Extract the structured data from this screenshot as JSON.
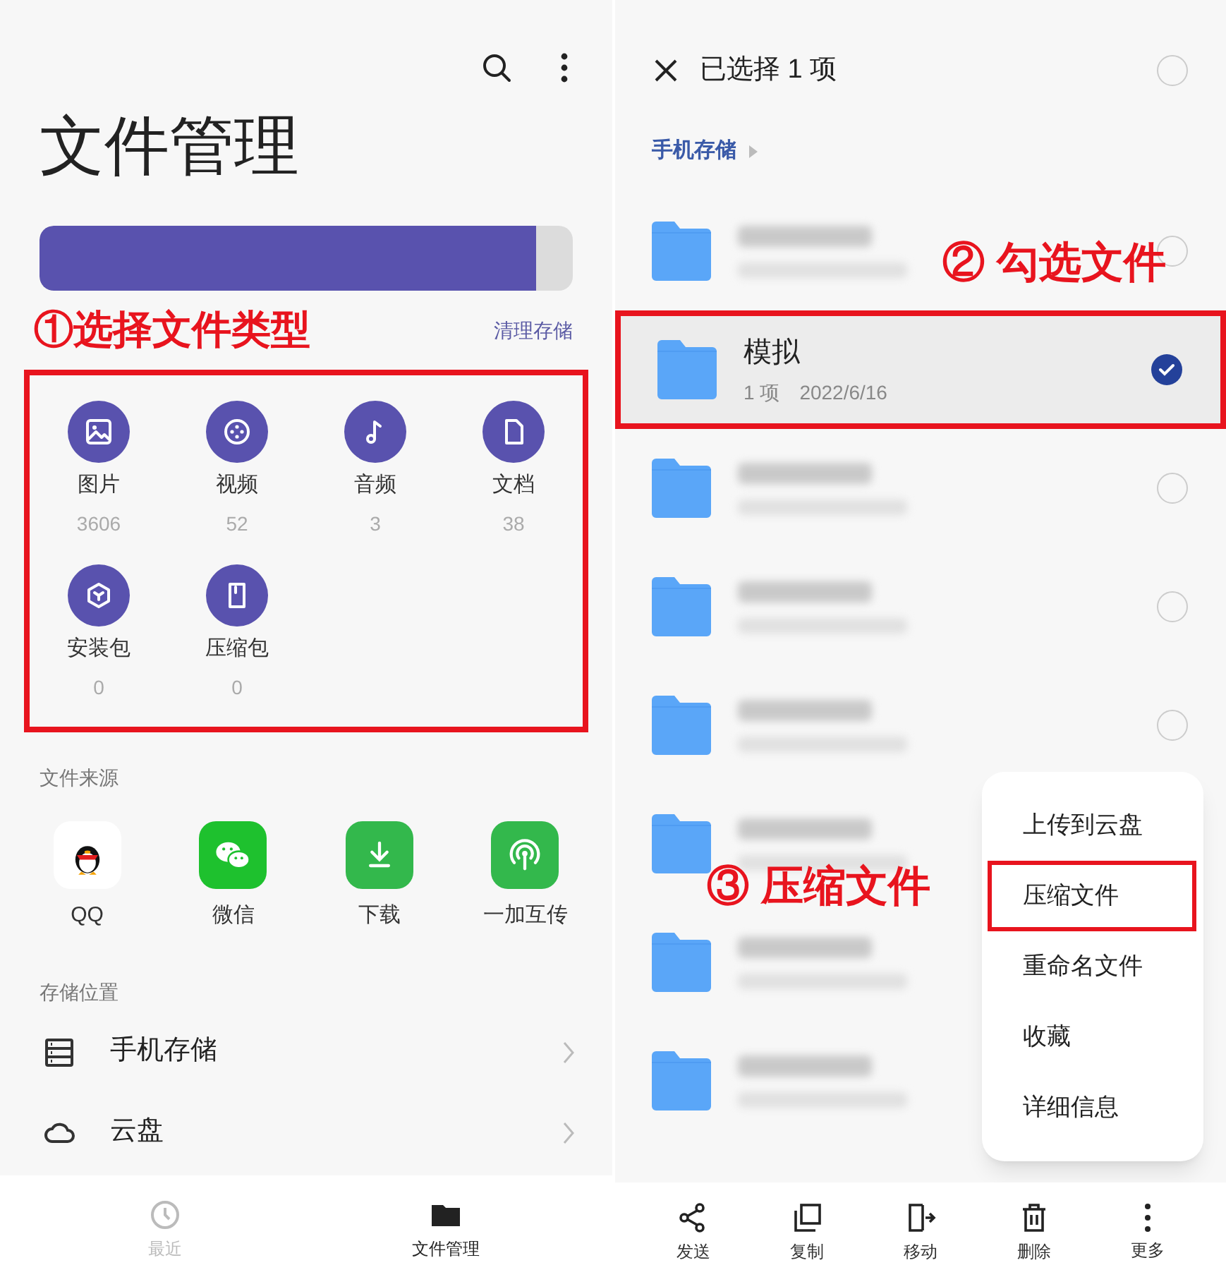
{
  "left": {
    "title": "文件管理",
    "storage": {
      "level": 0.93
    },
    "annotation": "①选择文件类型",
    "clean_link": "清理存储",
    "categories": [
      {
        "label": "图片",
        "count": "3606",
        "kind": "image"
      },
      {
        "label": "视频",
        "count": "52",
        "kind": "video"
      },
      {
        "label": "音频",
        "count": "3",
        "kind": "audio"
      },
      {
        "label": "文档",
        "count": "38",
        "kind": "doc"
      },
      {
        "label": "安装包",
        "count": "0",
        "kind": "package"
      },
      {
        "label": "压缩包",
        "count": "0",
        "kind": "archive"
      }
    ],
    "sources_heading": "文件来源",
    "sources": [
      {
        "label": "QQ",
        "kind": "qq"
      },
      {
        "label": "微信",
        "kind": "wechat"
      },
      {
        "label": "下载",
        "kind": "download"
      },
      {
        "label": "一加互传",
        "kind": "transfer"
      }
    ],
    "locations_heading": "存储位置",
    "locations": [
      {
        "label": "手机存储",
        "kind": "local"
      },
      {
        "label": "云盘",
        "kind": "cloud"
      }
    ],
    "tabs": [
      {
        "label": "最近",
        "kind": "recent",
        "selected": false
      },
      {
        "label": "文件管理",
        "kind": "files",
        "selected": true
      }
    ]
  },
  "right": {
    "title": "已选择 1 项",
    "select_all": {
      "checked": false
    },
    "breadcrumb": "手机存储",
    "annotation_check": "② 勾选文件",
    "annotation_menu": "③ 压缩文件",
    "folders": [
      {
        "kind": "blurred",
        "checked": false
      },
      {
        "kind": "named",
        "name": "模拟",
        "count": "1 项",
        "date": "2022/6/16",
        "checked": true
      },
      {
        "kind": "blurred",
        "checked": false
      },
      {
        "kind": "blurred",
        "checked": false
      },
      {
        "kind": "blurred",
        "checked": false
      },
      {
        "kind": "blurred"
      },
      {
        "kind": "blurred"
      },
      {
        "kind": "blurred"
      }
    ],
    "menu": [
      {
        "label": "上传到云盘",
        "highlighted": false
      },
      {
        "label": "压缩文件",
        "highlighted": true
      },
      {
        "label": "重命名文件",
        "highlighted": false
      },
      {
        "label": "收藏",
        "highlighted": false
      },
      {
        "label": "详细信息",
        "highlighted": false
      }
    ],
    "toolbar": [
      {
        "label": "发送",
        "kind": "send"
      },
      {
        "label": "复制",
        "kind": "copy"
      },
      {
        "label": "移动",
        "kind": "move"
      },
      {
        "label": "删除",
        "kind": "delete"
      },
      {
        "label": "更多",
        "kind": "more"
      }
    ]
  }
}
